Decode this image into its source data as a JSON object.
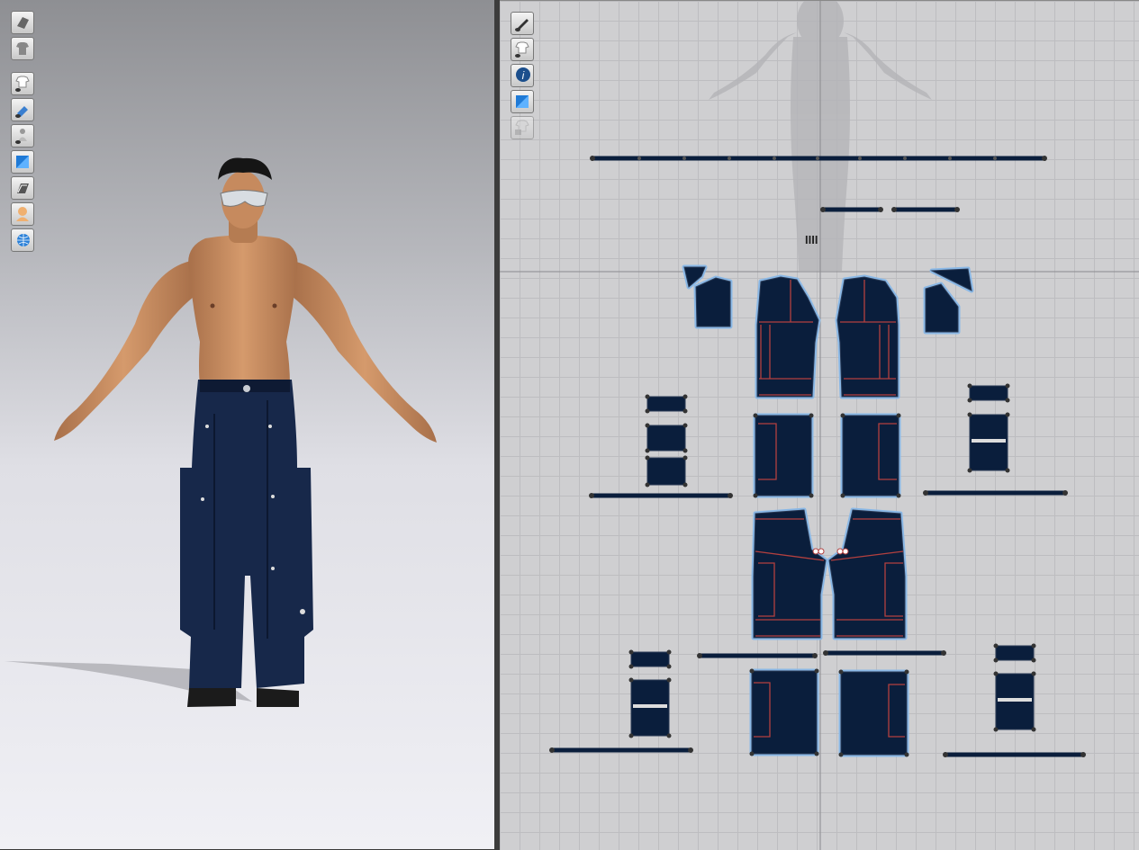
{
  "app": {
    "views": [
      "3d-avatar-view",
      "2d-pattern-view"
    ]
  },
  "toolbar_3d": {
    "icons": [
      "garment-solid-icon",
      "garment-shirt-icon",
      "show-garment-icon",
      "show-arrangement-icon",
      "show-avatar-icon",
      "texture-view-icon",
      "show-mesh-icon",
      "avatar-skin-icon",
      "show-environment-icon"
    ]
  },
  "toolbar_2d": {
    "icons": [
      "pen-tool-icon",
      "show-shirt-icon",
      "info-icon",
      "texture-2d-icon",
      "lock-icon"
    ]
  },
  "colors": {
    "fabric": "#0a1e3c",
    "selection_outline": "#8ab8e6",
    "internal_line": "#b3403f",
    "grid": "#bdbdc0",
    "background_2d": "#cfcfd1",
    "skin": "#c68a5e"
  }
}
